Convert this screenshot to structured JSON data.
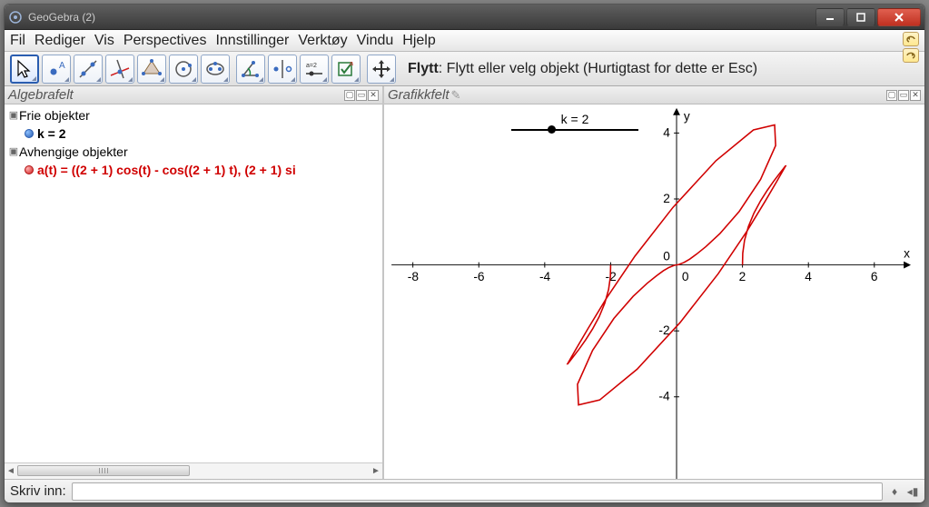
{
  "window": {
    "title": "GeoGebra (2)"
  },
  "menu": {
    "file": "Fil",
    "edit": "Rediger",
    "view": "Vis",
    "perspectives": "Perspectives",
    "settings": "Innstillinger",
    "tools": "Verktøy",
    "window": "Vindu",
    "help": "Hjelp"
  },
  "toolbar": {
    "desc_title": "Flytt",
    "desc_rest": ": Flytt eller velg objekt (Hurtigtast for dette er Esc)"
  },
  "panes": {
    "algebra_title": "Algebrafelt",
    "graphics_title": "Grafikkfelt"
  },
  "tree": {
    "free_label": "Frie objekter",
    "k_label": "k = 2",
    "dep_label": "Avhengige objekter",
    "a_label": "a(t) = ((2 + 1) cos(t) - cos((2 + 1) t), (2 + 1) si"
  },
  "slider": {
    "label": "k = 2"
  },
  "axes": {
    "x_label": "x",
    "y_label": "y",
    "x_ticks": {
      "m8": "-8",
      "m6": "-6",
      "m4": "-4",
      "m2": "-2",
      "0": "0",
      "2": "2",
      "4": "4",
      "6": "6"
    },
    "y_ticks": {
      "4": "4",
      "2": "2",
      "0": "0",
      "m2": "-2",
      "m4": "-4"
    }
  },
  "inputbar": {
    "label": "Skriv inn:",
    "value": ""
  },
  "chart_data": {
    "type": "parametric-curve",
    "title": "",
    "xlabel": "x",
    "ylabel": "y",
    "xlim": [
      -9,
      7
    ],
    "ylim": [
      -5,
      5
    ],
    "x_ticks": [
      -8,
      -6,
      -4,
      -2,
      0,
      2,
      4,
      6
    ],
    "y_ticks": [
      -4,
      -2,
      0,
      2,
      4
    ],
    "parameters": {
      "k": 2
    },
    "series": [
      {
        "name": "a(t)",
        "color": "#d00000",
        "formula": "x(t) = (k+1) cos(t) - cos((k+1) t),  y(t) = (k+1) sin(t) - sin((k+1) t)",
        "t_range": [
          0,
          6.283185307
        ],
        "samples": [
          [
            2.0,
            0.0
          ],
          [
            2.008,
            0.358
          ],
          [
            2.063,
            0.745
          ],
          [
            2.179,
            1.163
          ],
          [
            2.349,
            1.572
          ],
          [
            2.549,
            1.943
          ],
          [
            2.755,
            2.266
          ],
          [
            2.947,
            2.537
          ],
          [
            3.11,
            2.753
          ],
          [
            3.232,
            2.911
          ],
          [
            3.302,
            3.0
          ],
          [
            3.309,
            3.0
          ],
          [
            3.232,
            2.867
          ],
          [
            3.042,
            2.537
          ],
          [
            2.695,
            1.943
          ],
          [
            2.124,
            1.006
          ],
          [
            1.264,
            -0.266
          ],
          [
            0.107,
            -1.747
          ],
          [
            -1.195,
            -3.159
          ],
          [
            -2.333,
            -4.095
          ],
          [
            -2.977,
            -4.245
          ],
          [
            -3.005,
            -3.618
          ],
          [
            -2.549,
            -2.592
          ],
          [
            -1.902,
            -1.625
          ],
          [
            -1.318,
            -0.955
          ],
          [
            -0.889,
            -0.553
          ],
          [
            -0.604,
            -0.324
          ],
          [
            -0.4,
            -0.176
          ],
          [
            -0.222,
            -0.072
          ],
          [
            -0.06,
            -0.009
          ],
          [
            0.06,
            0.009
          ],
          [
            0.222,
            0.072
          ],
          [
            0.4,
            0.176
          ],
          [
            0.604,
            0.324
          ],
          [
            0.889,
            0.553
          ],
          [
            1.318,
            0.955
          ],
          [
            1.902,
            1.625
          ],
          [
            2.549,
            2.592
          ],
          [
            3.005,
            3.618
          ],
          [
            2.977,
            4.245
          ],
          [
            2.333,
            4.095
          ],
          [
            1.195,
            3.159
          ],
          [
            -0.107,
            1.747
          ],
          [
            -1.264,
            0.266
          ],
          [
            -2.124,
            -1.006
          ],
          [
            -2.695,
            -1.943
          ],
          [
            -3.042,
            -2.537
          ],
          [
            -3.232,
            -2.867
          ],
          [
            -3.309,
            -3.0
          ],
          [
            -3.302,
            -3.0
          ],
          [
            -3.232,
            -2.911
          ],
          [
            -3.11,
            -2.753
          ],
          [
            -2.947,
            -2.537
          ],
          [
            -2.755,
            -2.266
          ],
          [
            -2.549,
            -1.943
          ],
          [
            -2.349,
            -1.572
          ],
          [
            -2.179,
            -1.163
          ],
          [
            -2.063,
            -0.745
          ],
          [
            -2.008,
            -0.358
          ],
          [
            -2.0,
            0.0
          ]
        ]
      }
    ],
    "sliders": [
      {
        "name": "k",
        "value": 2,
        "min": -5,
        "max": 5
      }
    ]
  }
}
